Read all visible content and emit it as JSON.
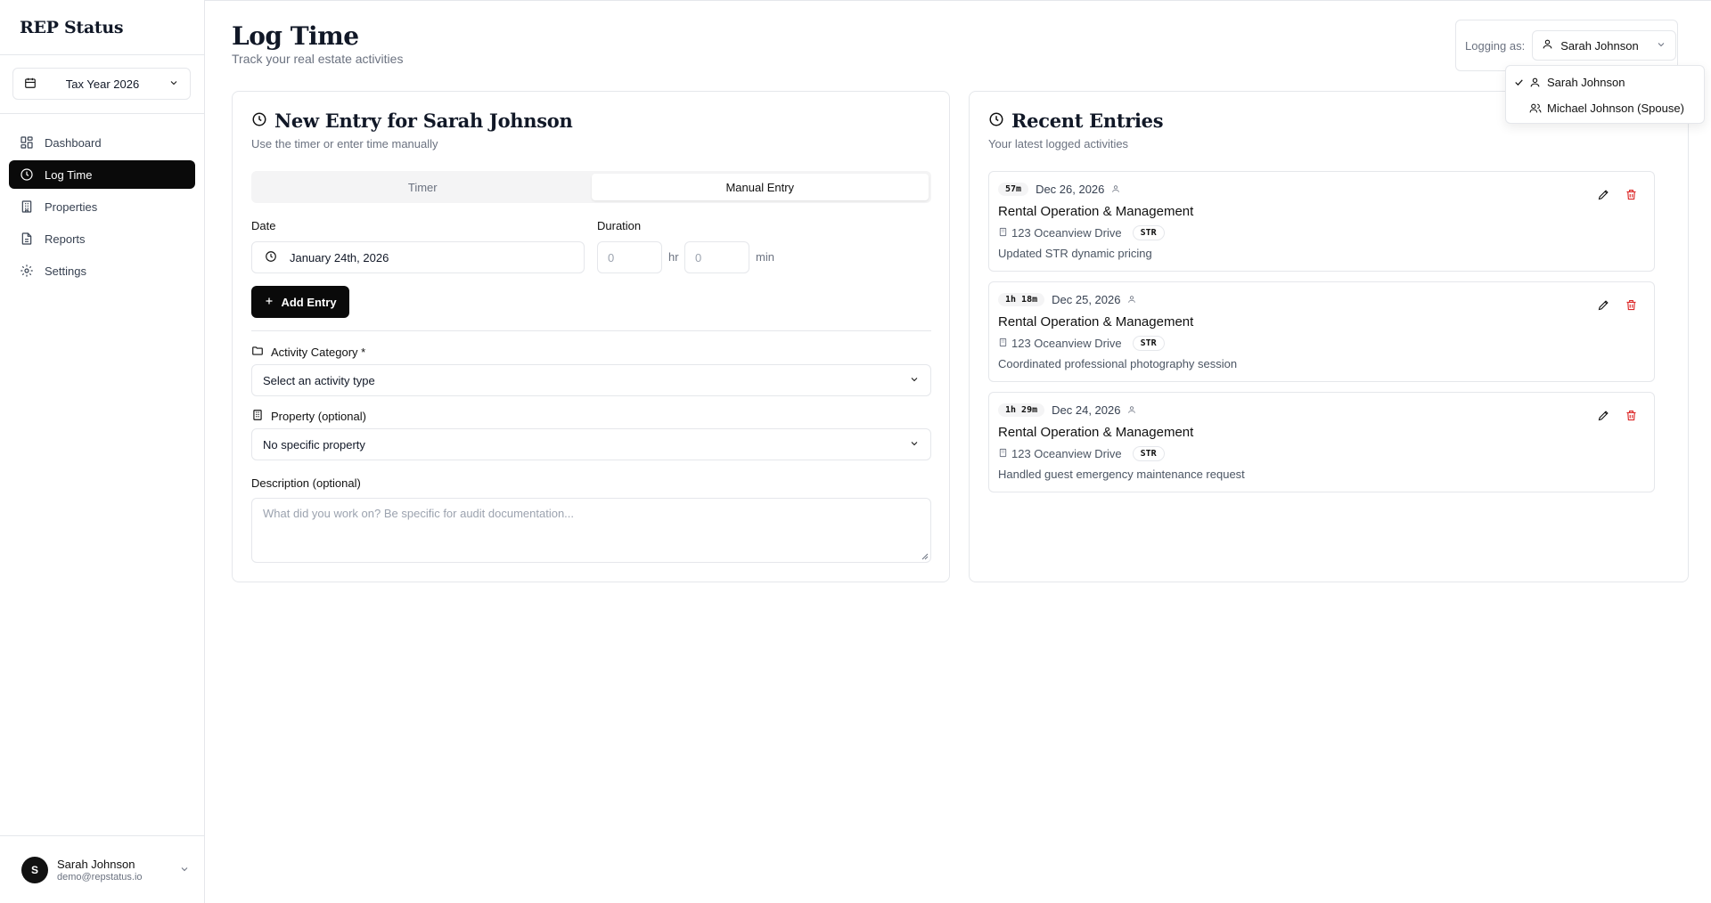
{
  "app": {
    "brand": "REP Status"
  },
  "sidebar": {
    "year_select": "Tax Year 2026",
    "items": [
      {
        "label": "Dashboard",
        "icon": "dashboard-icon"
      },
      {
        "label": "Log Time",
        "icon": "clock-icon",
        "active": true
      },
      {
        "label": "Properties",
        "icon": "building-icon"
      },
      {
        "label": "Reports",
        "icon": "document-icon"
      },
      {
        "label": "Settings",
        "icon": "gear-icon"
      }
    ],
    "user": {
      "initial": "S",
      "name": "Sarah Johnson",
      "email": "demo@repstatus.io"
    }
  },
  "header": {
    "title": "Log Time",
    "subtitle": "Track your real estate activities",
    "logging_label": "Logging as:",
    "logging_value": "Sarah Johnson",
    "dropdown": [
      {
        "label": "Sarah Johnson",
        "selected": true
      },
      {
        "label": "Michael Johnson (Spouse)",
        "selected": false
      }
    ]
  },
  "new_entry": {
    "title": "New Entry for Sarah Johnson",
    "subtitle": "Use the timer or enter time manually",
    "tabs": [
      "Timer",
      "Manual Entry"
    ],
    "active_tab": "Manual Entry",
    "date_label": "Date",
    "date_value": "January 24th, 2026",
    "duration_label": "Duration",
    "hours_placeholder": "0",
    "hours_unit": "hr",
    "minutes_placeholder": "0",
    "minutes_unit": "min",
    "add_button": "Add Entry",
    "category_label": "Activity Category *",
    "category_placeholder": "Select an activity type",
    "property_label": "Property (optional)",
    "property_value": "No specific property",
    "description_label": "Description (optional)",
    "description_placeholder": "What did you work on? Be specific for audit documentation..."
  },
  "recent": {
    "title": "Recent Entries",
    "subtitle": "Your latest logged activities",
    "entries": [
      {
        "duration": "57m",
        "date": "Dec 26, 2026",
        "title": "Rental Operation & Management",
        "property": "123 Oceanview Drive",
        "tag": "STR",
        "description": "Updated STR dynamic pricing"
      },
      {
        "duration": "1h 18m",
        "date": "Dec 25, 2026",
        "title": "Rental Operation & Management",
        "property": "123 Oceanview Drive",
        "tag": "STR",
        "description": "Coordinated professional photography session"
      },
      {
        "duration": "1h 29m",
        "date": "Dec 24, 2026",
        "title": "Rental Operation & Management",
        "property": "123 Oceanview Drive",
        "tag": "STR",
        "description": "Handled guest emergency maintenance request"
      }
    ]
  },
  "colors": {
    "accent": "#0a0a0a",
    "danger": "#dc2626",
    "border": "#e5e7eb",
    "muted": "#6b7280"
  }
}
